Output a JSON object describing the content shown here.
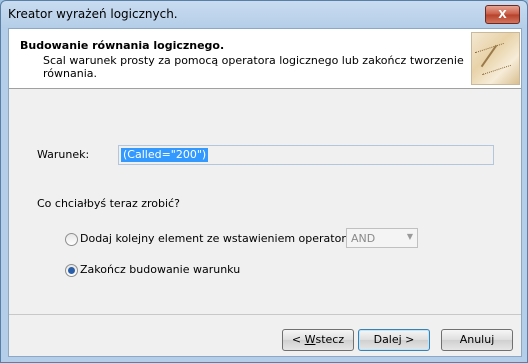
{
  "window": {
    "title": "Kreator wyrażeń logicznych.",
    "close_label": "X"
  },
  "header": {
    "title": "Budowanie równania logicznego.",
    "subtitle": "Scal warunek prosty za pomocą operatora logicznego lub zakończ tworzenie równania."
  },
  "condition": {
    "label": "Warunek:",
    "value": "(Called=\"200\")"
  },
  "question": "Co chciałbyś teraz zrobić?",
  "options": [
    {
      "label": "Dodaj kolejny element ze wstawieniem operatora",
      "selected": false
    },
    {
      "label": "Zakończ budowanie warunku",
      "selected": true
    }
  ],
  "operator_select": {
    "value": "AND",
    "enabled": false
  },
  "buttons": {
    "back_prefix": "< ",
    "back_mnemonic": "W",
    "back_rest": "stecz",
    "next": "Dalej >",
    "cancel": "Anuluj"
  }
}
